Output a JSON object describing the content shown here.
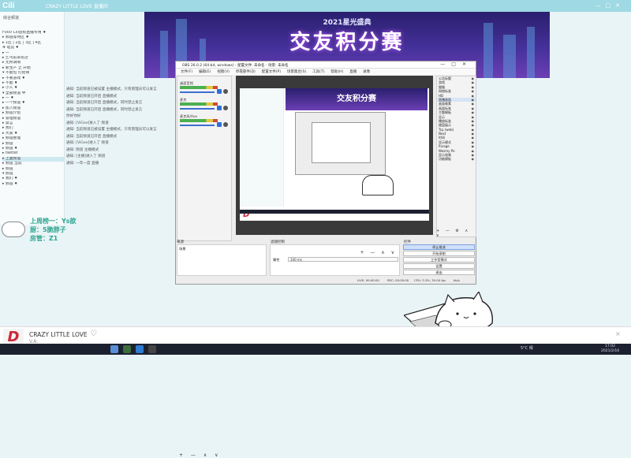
{
  "app": {
    "logo": "Cili",
    "title": "CRAZY LITTLE LOVE 直播间",
    "window_controls": [
      "—",
      "□",
      "✕"
    ]
  },
  "sidebar": {
    "header": "综合频道",
    "items": [
      "F000 Cili鼠标直播专用 ♦",
      "▸ 频道等待区 ♦",
      "▸ 1区 | 2区 | 3区 | 4区",
      "    ⊕ 电竞 ♦",
      "  ▸ 一",
      "  ▸ 乞丐前辈玩过",
      "  ▸ 无所谓啊",
      "  ▸ 新生产 之 开始",
      "  ▾ 不能包 打扰啊",
      "    ▸ 不要游戏 ♦",
      "    ▸ 不能 ♦",
      "    ▸ 小人 ♦",
      "  ▾ 全部频道 中",
      "    ▸ 一 ♦",
      "    ▸ 一个频道 ♦",
      "  ▸ 加入频道",
      "  ▸ 频道介绍",
      "  ▸ 管理频道",
      "  ▸ 禁言",
      "    ▸ 我们",
      "    ▸ 大家 ♦",
      "  ▸ 频道整理",
      "  ▸ 频道",
      "  ▸ 频道 ♦",
      "  ▸ twitter",
      "  ▸ 上面频道",
      "  ▸ 频道 当前",
      "  ▸ 频道",
      "▾ 频道",
      "  ▸ 我们 ♦",
      "  ▸ 频道 ♦"
    ]
  },
  "banner": {
    "subtitle": "2021星光盛典",
    "title": "交友积分赛"
  },
  "chat": {
    "messages": [
      "通知: 当前频道已被设置 主播模式，只有管理员可以发言",
      "通知: 当前频道已开启 直播模式",
      "通知: 当前频道已开启 直播模式，同时禁止发言",
      "通知: 当前频道已开启 直播模式，同时禁止发言",
      "你好你好",
      "通知: [ViGee]进入了 频道",
      "通知: 当前频道已被设置 主播模式，只有管理员可以发言",
      "通知: 当前频道已开启 直播模式",
      "通知: [ViGee]进入了 频道",
      "通知: 频道 主播模式",
      "通知: [主播]进入了 频道",
      "通知: 一年一度 直播"
    ]
  },
  "overlay": {
    "line1": "上周榜一：Ys歆",
    "line2": "厨：5脆脖子",
    "line3": "房管：Z1"
  },
  "player": {
    "song": "CRAZY LITTLE LOVE",
    "artist": "V.A.",
    "album_letter": "D",
    "close": "×"
  },
  "taskbar": {
    "tray": "5°C 晴",
    "time": "17:02",
    "date": "2021/2/16"
  },
  "obs": {
    "title": "OBS 26.0.2 (64-bit, windows) - 配置文件: 未命名 - 场景: 未命名",
    "menu": [
      "文件(F)",
      "编辑(E)",
      "视图(V)",
      "停靠部件(D)",
      "配置文件(P)",
      "场景集合(S)",
      "工具(T)",
      "帮助(H)",
      "直播",
      "录像"
    ],
    "mixer": {
      "channels": [
        "桌面音频",
        "麦克",
        "麦克风/Aux"
      ]
    },
    "preview_banner": "交友积分赛",
    "preview_album": "D",
    "scenes": [
      "公告标题",
      "游戏",
      "猫猫",
      "网络标准",
      "HD",
      "直播画面",
      "画面像素",
      "画面标准",
      "主题模板",
      "显示",
      "播放标准",
      "键盘展示",
      "Tcp (web)",
      "Next",
      "时间",
      "显示模式",
      "Rivage",
      "Wesmy Pe",
      "显示效果",
      "功能模板"
    ],
    "scenes_toolbar": "+ — ⚙ ∧ ∨",
    "sources_header": "来源",
    "source_item": "场景",
    "sources_toolbar": "+ — ∧ ∨",
    "filters_header": "滤镜控制",
    "filter_field_label": "属性",
    "filter_field_value": "100 ms",
    "filter_buttons": "+ — ∧ ∨",
    "controls_header": "控件",
    "controls": [
      "停止推流",
      "开始录制",
      "工作室模式",
      "设置",
      "退出"
    ],
    "status": {
      "live": "LIVE: 00:00:00",
      "rec": "REC: 00:00:00",
      "cpu": "CPU: 3.3%, 30.00 fps",
      "bitrate": "kb/s"
    }
  }
}
